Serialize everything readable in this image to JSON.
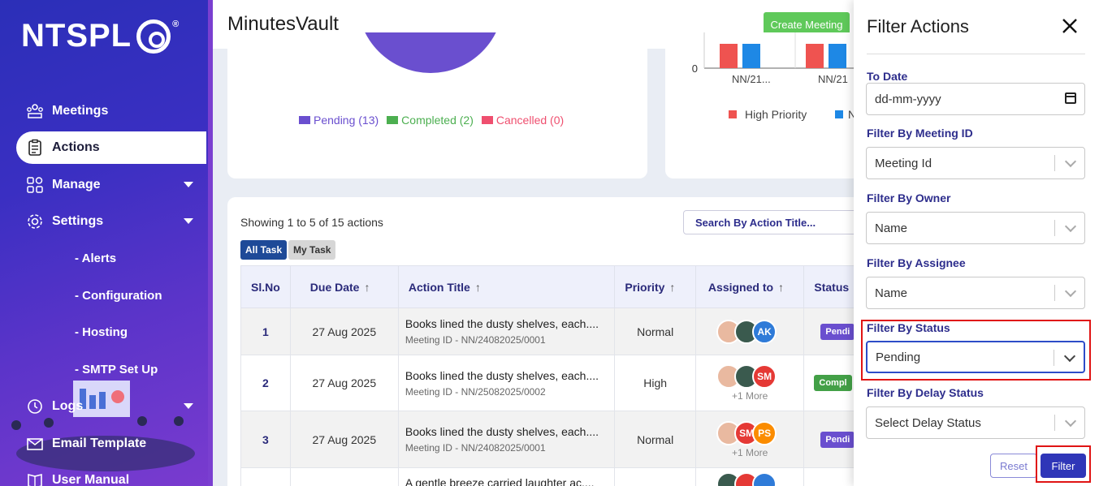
{
  "sidebar": {
    "logo": "NTSPL",
    "logo_mark": "®",
    "items": [
      {
        "label": "Meetings",
        "icon": "meetings-icon"
      },
      {
        "label": "Actions",
        "icon": "clipboard-icon"
      },
      {
        "label": "Manage",
        "icon": "grid-icon"
      },
      {
        "label": "Settings",
        "icon": "gear-icon"
      },
      {
        "label": "Logs",
        "icon": "history-icon"
      },
      {
        "label": "Email Template",
        "icon": "email-icon"
      },
      {
        "label": "User Manual",
        "icon": "book-icon"
      }
    ],
    "sub_items": [
      "- Alerts",
      "- Configuration",
      "- Hosting",
      "- SMTP Set Up"
    ]
  },
  "header": {
    "title": "MinutesVault",
    "create_button": "Create Meeting"
  },
  "pie_legend": [
    {
      "label": "Pending (13)",
      "color": "#6a4fcf"
    },
    {
      "label": "Completed (2)",
      "color": "#4caf50"
    },
    {
      "label": "Cancelled (0)",
      "color": "#ef4f6f"
    }
  ],
  "bar_chart": {
    "zero_label": "0",
    "categories": [
      "NN/21...",
      "NN/21"
    ],
    "legend": [
      "High Priority",
      "N"
    ]
  },
  "table": {
    "showing": "Showing 1 to 5 of 15 actions",
    "search_placeholder": "Search By Action Title...",
    "chips": [
      "All Task",
      "My Task"
    ],
    "headers": [
      "Sl.No",
      "Due Date",
      "Action Title",
      "Priority",
      "Assigned to",
      "Status"
    ],
    "sort_arrow": "↑",
    "rows": [
      {
        "sl": "1",
        "due": "27 Aug 2025",
        "title": "Books lined the dusty shelves, each....",
        "meeting": "Meeting ID - NN/24082025/0001",
        "priority": "Normal",
        "avatars": [
          "",
          "",
          "AK"
        ],
        "more": "",
        "status": "Pendi"
      },
      {
        "sl": "2",
        "due": "27 Aug 2025",
        "title": "Books lined the dusty shelves, each....",
        "meeting": "Meeting ID - NN/25082025/0002",
        "priority": "High",
        "avatars": [
          "",
          "",
          "SM"
        ],
        "more": "+1 More",
        "status": "Compl"
      },
      {
        "sl": "3",
        "due": "27 Aug 2025",
        "title": "Books lined the dusty shelves, each....",
        "meeting": "Meeting ID - NN/24082025/0001",
        "priority": "Normal",
        "avatars": [
          "",
          "SM",
          "PS"
        ],
        "more": "+1 More",
        "status": "Pendi"
      },
      {
        "sl": "",
        "due": "",
        "title": "A gentle breeze carried laughter ac....",
        "meeting": "",
        "priority": "",
        "avatars": [],
        "more": "",
        "status": ""
      }
    ]
  },
  "filter_panel": {
    "title": "Filter Actions",
    "to_date_label": "To Date",
    "to_date_value": "dd-mm-yyyy",
    "meeting_id_label": "Filter By Meeting ID",
    "meeting_id_value": "Meeting Id",
    "owner_label": "Filter By Owner",
    "owner_value": "Name",
    "assignee_label": "Filter By Assignee",
    "assignee_value": "Name",
    "status_label": "Filter By Status",
    "status_value": "Pending",
    "delay_label": "Filter By Delay Status",
    "delay_value": "Select Delay Status",
    "reset_button": "Reset",
    "filter_button": "Filter"
  }
}
